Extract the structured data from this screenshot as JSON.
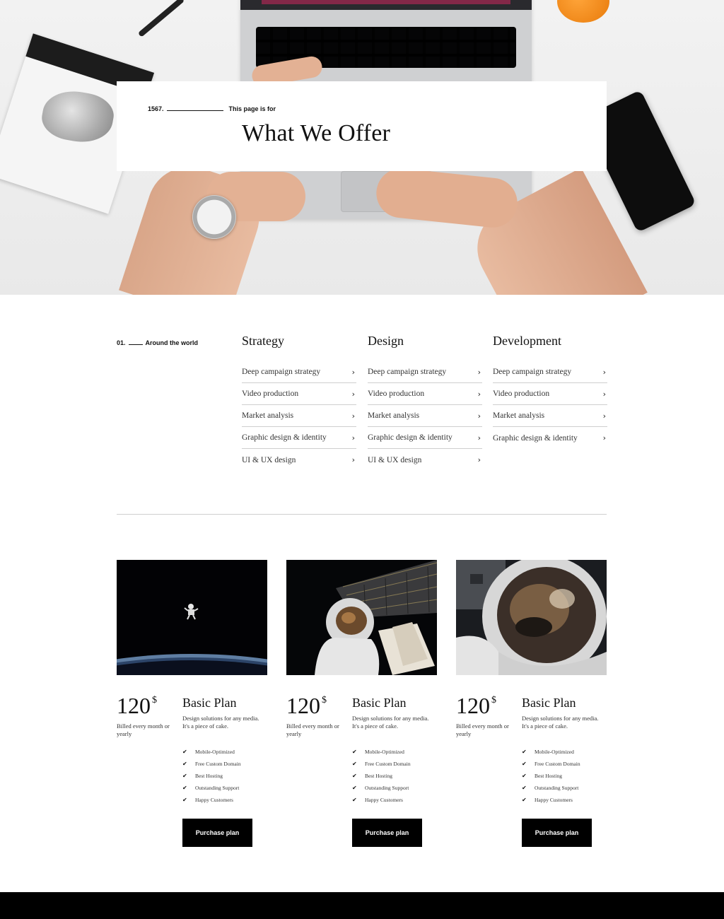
{
  "hero": {
    "number": "1567.",
    "tagline": "This page is for",
    "title": "What We Offer"
  },
  "services": {
    "number": "01.",
    "subtitle": "Around the world",
    "columns": [
      {
        "title": "Strategy",
        "items": [
          "Deep campaign strategy",
          "Video production",
          "Market analysis",
          "Graphic design & identity",
          "UI & UX design"
        ]
      },
      {
        "title": "Design",
        "items": [
          "Deep campaign strategy",
          "Video production",
          "Market analysis",
          "Graphic design & identity",
          "UI & UX design"
        ]
      },
      {
        "title": "Development",
        "items": [
          "Deep campaign strategy",
          "Video production",
          "Market analysis",
          "Graphic design & identity"
        ]
      }
    ]
  },
  "plans": [
    {
      "image": "astronaut-floating-above-earth",
      "price": "120",
      "currency": "$",
      "billing": "Billed every month or yearly",
      "name": "Basic Plan",
      "description": "Design solutions for any media. It's a piece of cake.",
      "features": [
        "Mobile-Optimized",
        "Free Custom Domain",
        "Best Hosting",
        "Outstanding Support",
        "Happy Customers"
      ],
      "button": "Purchase plan"
    },
    {
      "image": "astronaut-spacewalk-solar-panels",
      "price": "120",
      "currency": "$",
      "billing": "Billed every month or yearly",
      "name": "Basic Plan",
      "description": "Design solutions for any media. It's a piece of cake.",
      "features": [
        "Mobile-Optimized",
        "Free Custom Domain",
        "Best Hosting",
        "Outstanding Support",
        "Happy Customers"
      ],
      "button": "Purchase plan"
    },
    {
      "image": "astronaut-helmet-closeup",
      "price": "120",
      "currency": "$",
      "billing": "Billed every month or yearly",
      "name": "Basic Plan",
      "description": "Design solutions for any media. It's a piece of cake.",
      "features": [
        "Mobile-Optimized",
        "Free Custom Domain",
        "Best Hosting",
        "Outstanding Support",
        "Happy Customers"
      ],
      "button": "Purchase plan"
    }
  ],
  "icons": {
    "chevron": "chevron-right-icon",
    "check": "check-icon"
  }
}
